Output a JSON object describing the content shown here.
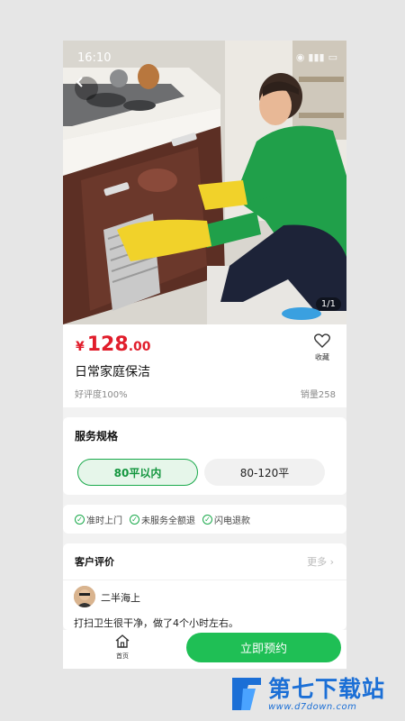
{
  "status_bar": {
    "time": "16:10"
  },
  "hero": {
    "counter": "1/1"
  },
  "product": {
    "price_symbol": "¥",
    "price_int": "128",
    "price_dec": ".00",
    "favorite_label": "收藏",
    "title": "日常家庭保洁",
    "rating": "好评度100%",
    "sales": "销量258"
  },
  "spec": {
    "title": "服务规格",
    "options": [
      {
        "label": "80平以内"
      },
      {
        "label": "80-120平"
      }
    ]
  },
  "guarantees": [
    {
      "label": "准时上门"
    },
    {
      "label": "未服务全额退"
    },
    {
      "label": "闪电退款"
    }
  ],
  "reviews": {
    "title": "客户评价",
    "more": "更多",
    "items": [
      {
        "name": "二半海上",
        "text": "打扫卫生很干净，做了4个小时左右。"
      }
    ]
  },
  "bottom_bar": {
    "home_label": "首页",
    "book_label": "立即预约"
  },
  "watermark": {
    "brand": "第七下载站",
    "url": "www.d7down.com"
  },
  "colors": {
    "accent": "#1fbf55",
    "price": "#e11d2b",
    "watermark": "#1b6fd6"
  }
}
